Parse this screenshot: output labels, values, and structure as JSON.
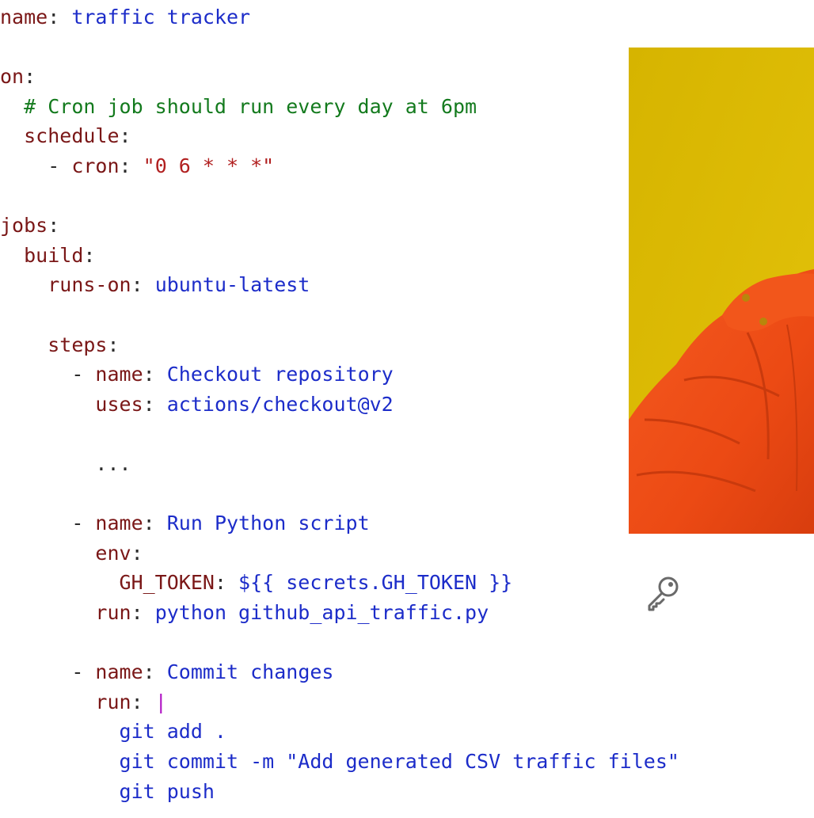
{
  "code_lines": [
    {
      "indent": "",
      "parts": [
        [
          "key",
          "name"
        ],
        [
          "punc",
          ": "
        ],
        [
          "val",
          "traffic tracker"
        ]
      ]
    },
    {
      "indent": "",
      "parts": []
    },
    {
      "indent": "",
      "parts": [
        [
          "key",
          "on"
        ],
        [
          "punc",
          ":"
        ]
      ]
    },
    {
      "indent": "  ",
      "parts": [
        [
          "cmt",
          "# Cron job should run every day at 6pm"
        ]
      ]
    },
    {
      "indent": "  ",
      "parts": [
        [
          "key",
          "schedule"
        ],
        [
          "punc",
          ":"
        ]
      ]
    },
    {
      "indent": "    ",
      "parts": [
        [
          "punc",
          "- "
        ],
        [
          "key",
          "cron"
        ],
        [
          "punc",
          ": "
        ],
        [
          "str",
          "\"0 6 * * *\""
        ]
      ]
    },
    {
      "indent": "",
      "parts": []
    },
    {
      "indent": "",
      "parts": [
        [
          "key",
          "jobs"
        ],
        [
          "punc",
          ":"
        ]
      ]
    },
    {
      "indent": "  ",
      "parts": [
        [
          "key",
          "build"
        ],
        [
          "punc",
          ":"
        ]
      ]
    },
    {
      "indent": "    ",
      "parts": [
        [
          "key",
          "runs-on"
        ],
        [
          "punc",
          ": "
        ],
        [
          "val",
          "ubuntu-latest"
        ]
      ]
    },
    {
      "indent": "",
      "parts": []
    },
    {
      "indent": "    ",
      "parts": [
        [
          "key",
          "steps"
        ],
        [
          "punc",
          ":"
        ]
      ]
    },
    {
      "indent": "      ",
      "parts": [
        [
          "punc",
          "- "
        ],
        [
          "key",
          "name"
        ],
        [
          "punc",
          ": "
        ],
        [
          "val",
          "Checkout repository"
        ]
      ]
    },
    {
      "indent": "        ",
      "parts": [
        [
          "key",
          "uses"
        ],
        [
          "punc",
          ": "
        ],
        [
          "val",
          "actions/checkout@v2"
        ]
      ]
    },
    {
      "indent": "",
      "parts": []
    },
    {
      "indent": "        ",
      "parts": [
        [
          "punc",
          "..."
        ]
      ]
    },
    {
      "indent": "",
      "parts": []
    },
    {
      "indent": "      ",
      "parts": [
        [
          "punc",
          "- "
        ],
        [
          "key",
          "name"
        ],
        [
          "punc",
          ": "
        ],
        [
          "val",
          "Run Python script"
        ]
      ]
    },
    {
      "indent": "        ",
      "parts": [
        [
          "key",
          "env"
        ],
        [
          "punc",
          ":"
        ]
      ]
    },
    {
      "indent": "          ",
      "parts": [
        [
          "key",
          "GH_TOKEN"
        ],
        [
          "punc",
          ": "
        ],
        [
          "val",
          "${{ secrets.GH_TOKEN }}"
        ]
      ]
    },
    {
      "indent": "        ",
      "parts": [
        [
          "key",
          "run"
        ],
        [
          "punc",
          ": "
        ],
        [
          "val",
          "python github_api_traffic.py"
        ]
      ]
    },
    {
      "indent": "",
      "parts": []
    },
    {
      "indent": "      ",
      "parts": [
        [
          "punc",
          "- "
        ],
        [
          "key",
          "name"
        ],
        [
          "punc",
          ": "
        ],
        [
          "val",
          "Commit changes"
        ]
      ]
    },
    {
      "indent": "        ",
      "parts": [
        [
          "key",
          "run"
        ],
        [
          "punc",
          ": "
        ],
        [
          "pipe",
          "|"
        ]
      ]
    },
    {
      "indent": "          ",
      "parts": [
        [
          "val",
          "git add ."
        ]
      ]
    },
    {
      "indent": "          ",
      "parts": [
        [
          "val",
          "git commit -m \"Add generated CSV traffic files\""
        ]
      ]
    },
    {
      "indent": "          ",
      "parts": [
        [
          "val",
          "git push"
        ]
      ]
    }
  ],
  "colors": {
    "key": "#7a1717",
    "value": "#1c2cc9",
    "string": "#b11f1f",
    "comment": "#137a1d",
    "pipe": "#b014c4",
    "photo_background": "#d9b800",
    "jacket": "#f0531c"
  },
  "icons": {
    "key_icon": "key-icon",
    "photo": "person-in-orange-jacket-photo"
  }
}
